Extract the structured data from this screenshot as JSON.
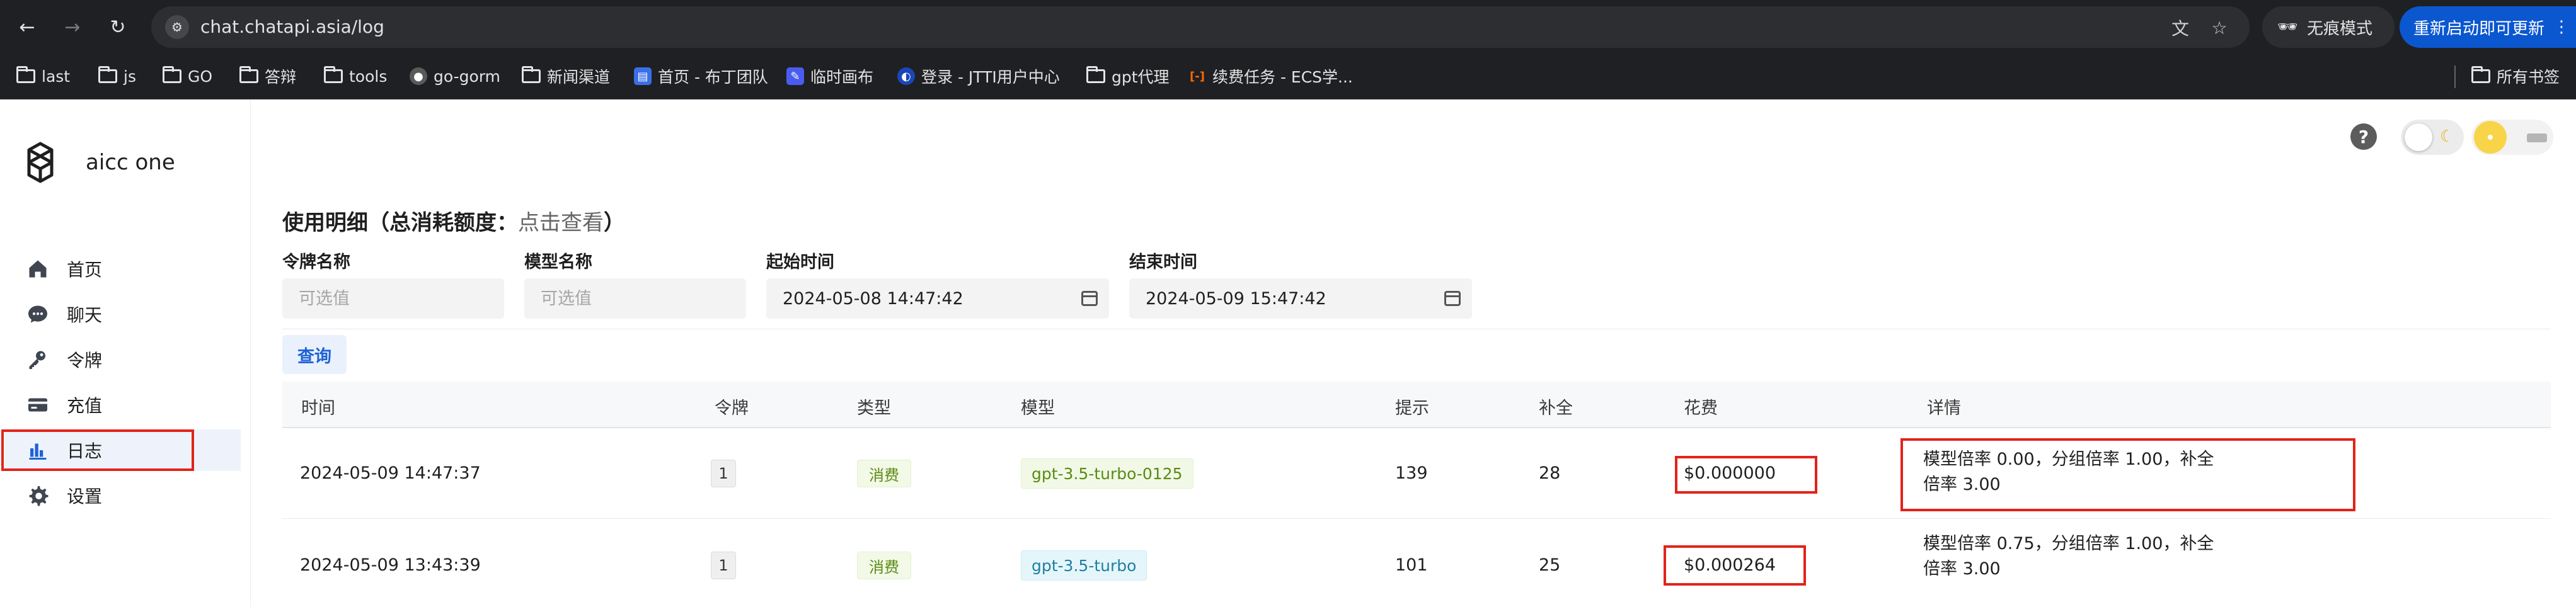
{
  "browser": {
    "url": "chat.chatapi.asia/log",
    "incognito_label": "无痕模式",
    "update_label": "重新启动即可更新",
    "bookmarks": [
      {
        "label": "last",
        "type": "folder"
      },
      {
        "label": "js",
        "type": "folder"
      },
      {
        "label": "GO",
        "type": "folder"
      },
      {
        "label": "答辩",
        "type": "folder"
      },
      {
        "label": "tools",
        "type": "folder"
      },
      {
        "label": "go-gorm",
        "type": "github"
      },
      {
        "label": "新闻渠道",
        "type": "folder"
      },
      {
        "label": "首页 - 布丁团队",
        "type": "doc"
      },
      {
        "label": "临时画布",
        "type": "canvas"
      },
      {
        "label": "登录 - JTTI用户中心",
        "type": "site"
      },
      {
        "label": "gpt代理",
        "type": "folder"
      },
      {
        "label": "续费任务 - ECS学...",
        "type": "aliyun"
      }
    ],
    "all_bookmarks_label": "所有书签"
  },
  "app": {
    "name": "aicc one",
    "nav": [
      {
        "label": "首页",
        "icon": "home-icon"
      },
      {
        "label": "聊天",
        "icon": "chat-icon"
      },
      {
        "label": "令牌",
        "icon": "key-icon"
      },
      {
        "label": "充值",
        "icon": "credit-card-icon"
      },
      {
        "label": "日志",
        "icon": "bar-chart-icon",
        "active": true
      },
      {
        "label": "设置",
        "icon": "gear-icon"
      }
    ]
  },
  "page": {
    "title_prefix": "使用明细（总消耗额度：",
    "title_link": "点击查看",
    "title_suffix": "）"
  },
  "filters": {
    "token_label": "令牌名称",
    "token_placeholder": "可选值",
    "model_label": "模型名称",
    "model_placeholder": "可选值",
    "start_label": "起始时间",
    "start_value": "2024-05-08 14:47:42",
    "end_label": "结束时间",
    "end_value": "2024-05-09 15:47:42",
    "query_label": "查询"
  },
  "table": {
    "columns": [
      "时间",
      "令牌",
      "类型",
      "模型",
      "提示",
      "补全",
      "花费",
      "详情"
    ],
    "rows": [
      {
        "time": "2024-05-09 14:47:37",
        "token": "1",
        "type": "消费",
        "model": "gpt-3.5-turbo-0125",
        "model_color": "green",
        "prompt": "139",
        "completion": "28",
        "cost": "$0.000000",
        "detail_line1": "模型倍率 0.00，分组倍率 1.00，补全",
        "detail_line2": "倍率 3.00"
      },
      {
        "time": "2024-05-09 13:43:39",
        "token": "1",
        "type": "消费",
        "model": "gpt-3.5-turbo",
        "model_color": "blue",
        "prompt": "101",
        "completion": "25",
        "cost": "$0.000264",
        "detail_line1": "模型倍率 0.75，分组倍率 1.00，补全",
        "detail_line2": "倍率 3.00"
      }
    ]
  },
  "colors": {
    "highlight_box": "#e2231a",
    "link_blue": "#1e63d6",
    "active_nav_bg": "#eef3fb"
  }
}
